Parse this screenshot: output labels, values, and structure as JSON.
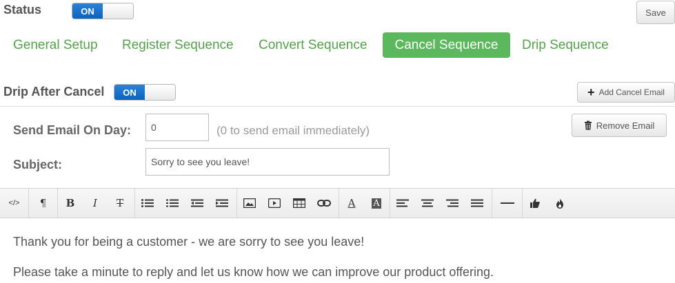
{
  "status": {
    "label": "Status",
    "toggle_on": "ON"
  },
  "header": {
    "save_label": "Save"
  },
  "tabs": [
    {
      "label": "General Setup",
      "active": false
    },
    {
      "label": "Register Sequence",
      "active": false
    },
    {
      "label": "Convert Sequence",
      "active": false
    },
    {
      "label": "Cancel Sequence",
      "active": true
    },
    {
      "label": "Drip Sequence",
      "active": false
    }
  ],
  "drip": {
    "label": "Drip After Cancel",
    "toggle_on": "ON",
    "add_label": "Add Cancel Email"
  },
  "form": {
    "day_label": "Send Email On Day:",
    "day_value": "0",
    "day_hint": "(0 to send email immediately)",
    "subject_label": "Subject:",
    "subject_value": "Sorry to see you leave!",
    "remove_label": "Remove Email"
  },
  "editor": {
    "paragraphs": [
      "Thank you for being a customer - we are sorry to see you leave!",
      "Please take a minute to reply and let us know how we can improve our product offering."
    ]
  },
  "colors": {
    "accent_green": "#5cb85c",
    "toggle_blue": "#0a64bf"
  }
}
